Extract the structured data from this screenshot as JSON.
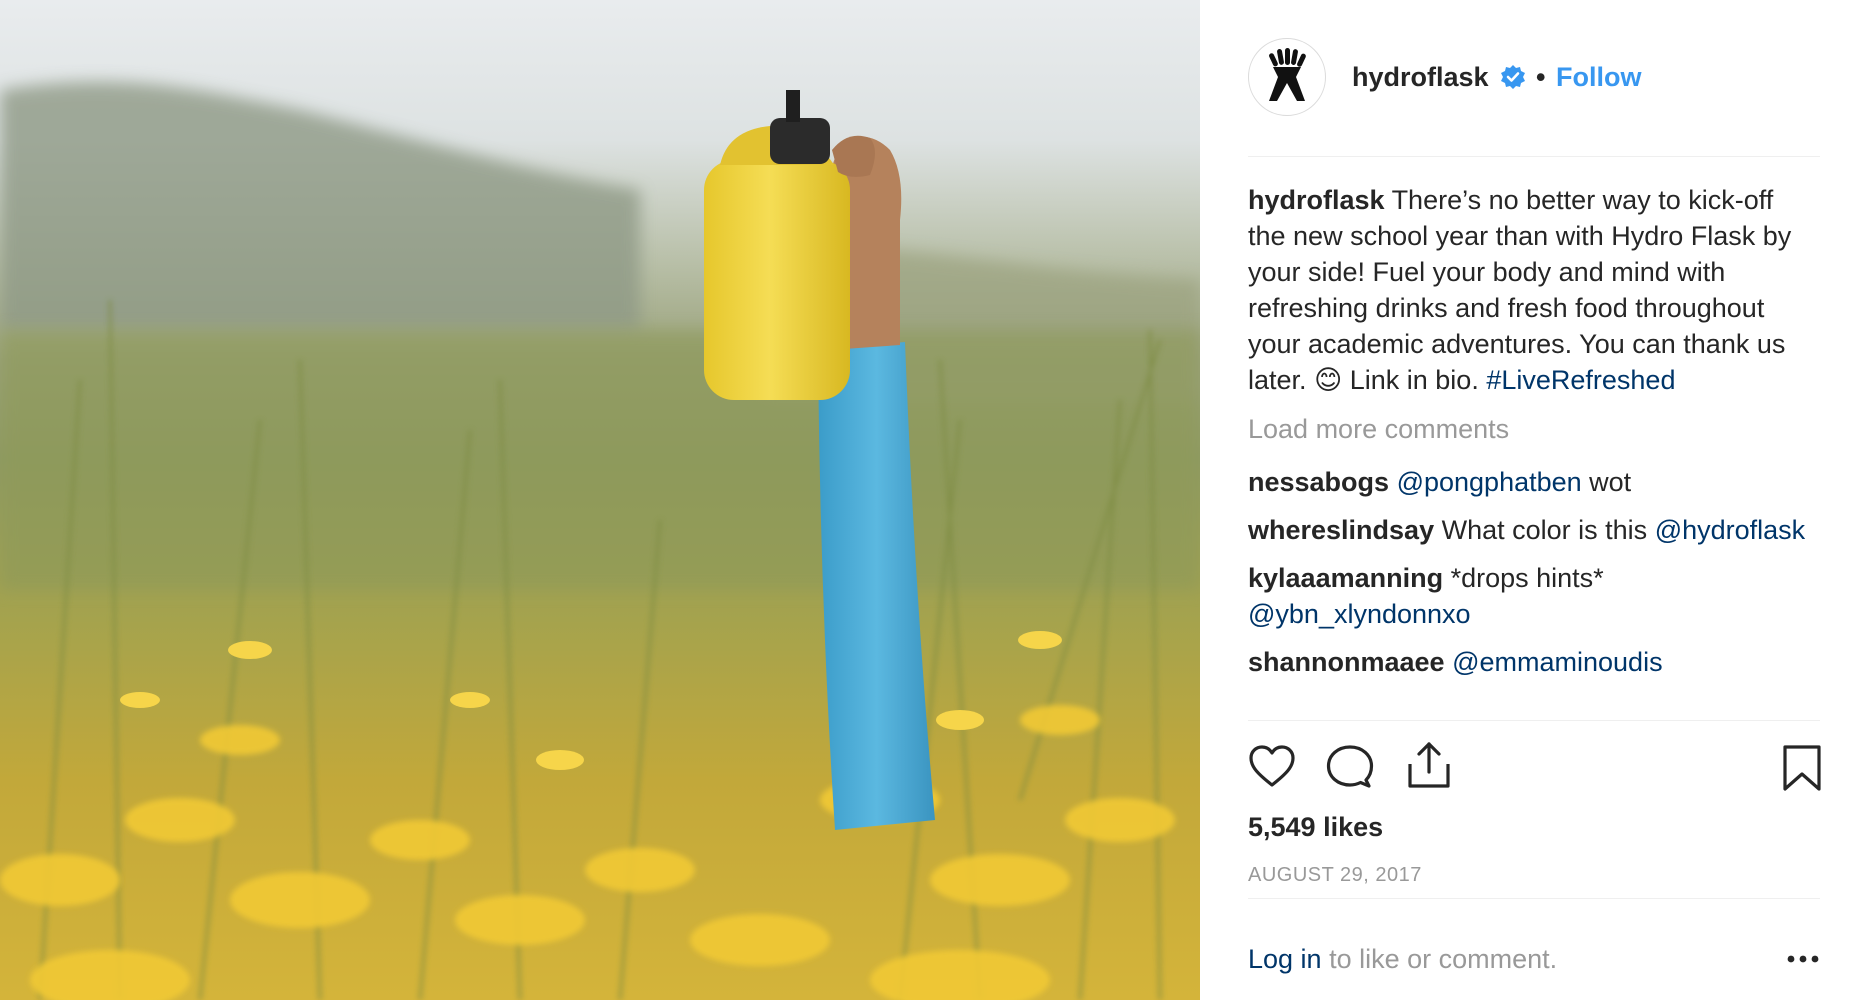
{
  "header": {
    "username": "hydroflask",
    "separator": "•",
    "follow_label": "Follow",
    "verified_icon": "verified-badge-icon",
    "avatar_icon": "hydroflask-logo"
  },
  "caption": {
    "username": "hydroflask",
    "text_before_emoji": "There’s no better way to kick-off the new school year than with Hydro Flask by your side! Fuel your body and mind with refreshing drinks and fresh food throughout your academic adventures. You can thank us later.",
    "emoji": "😊",
    "text_after_emoji": "Link in bio.",
    "hashtag": "#LiveRefreshed"
  },
  "load_more_label": "Load more comments",
  "comments": [
    {
      "username": "nessabogs",
      "mention": "@pongphatben",
      "text": "wot"
    },
    {
      "username": "whereslindsay",
      "text": "What color is this",
      "mention": "@hydroflask"
    },
    {
      "username": "kylaaamanning",
      "text": "*drops hints*",
      "mention": "@ybn_xlyndonnxo"
    },
    {
      "username": "shannonmaaee",
      "mention": "@emmaminoudis"
    }
  ],
  "actions": {
    "like_icon": "heart-icon",
    "comment_icon": "comment-bubble-icon",
    "share_icon": "share-upload-icon",
    "bookmark_icon": "bookmark-icon"
  },
  "likes": "5,549 likes",
  "date": "AUGUST 29, 2017",
  "footer": {
    "login_label": "Log in",
    "login_suffix": " to like or comment.",
    "more_icon": "more-options-icon"
  },
  "colors": {
    "link_blue": "#3897f0",
    "dark_link": "#003569",
    "muted_text": "#999999",
    "text": "#262626",
    "divider": "#efefef"
  }
}
